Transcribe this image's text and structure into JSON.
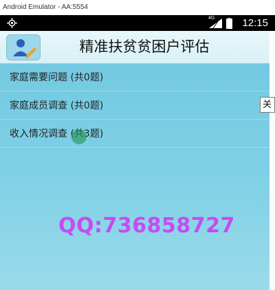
{
  "window": {
    "title": "Android Emulator - AA:5554"
  },
  "status_bar": {
    "network_label": "4G",
    "time": "12:15"
  },
  "app": {
    "title": "精准扶贫贫困户评估",
    "menu_items": [
      {
        "label": "家庭需要问题 (共0题)"
      },
      {
        "label": "家庭成员调查 (共0题)"
      },
      {
        "label": "收入情况调查 (共3题)"
      }
    ],
    "watermark": "QQ:736858727"
  },
  "tooltip": {
    "text": "关"
  }
}
